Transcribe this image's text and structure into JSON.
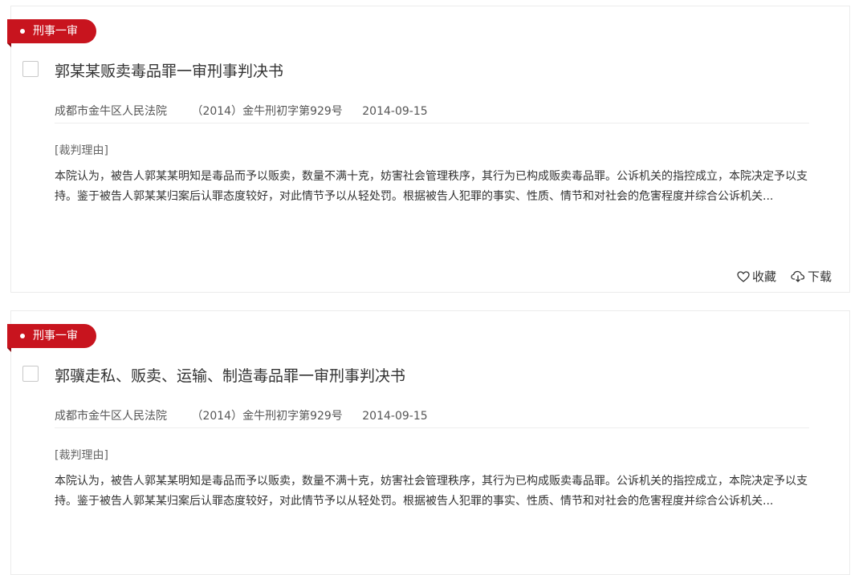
{
  "cards": [
    {
      "tag": "刑事一审",
      "title": "郭某某贩卖毒品罪一审刑事判决书",
      "court": "成都市金牛区人民法院",
      "case_number": "（2014）金牛刑初字第929号",
      "date": "2014-09-15",
      "reason_label": "[裁判理由]",
      "reason_text": "本院认为，被告人郭某某明知是毒品而予以贩卖，数量不满十克，妨害社会管理秩序，其行为已构成贩卖毒品罪。公诉机关的指控成立，本院决定予以支持。鉴于被告人郭某某归案后认罪态度较好，对此情节予以从轻处罚。根据被告人犯罪的事实、性质、情节和对社会的危害程度并综合公诉机关...",
      "favorite_label": "收藏",
      "download_label": "下载"
    },
    {
      "tag": "刑事一审",
      "title": "郭骥走私、贩卖、运输、制造毒品罪一审刑事判决书",
      "court": "成都市金牛区人民法院",
      "case_number": "（2014）金牛刑初字第929号",
      "date": "2014-09-15",
      "reason_label": "[裁判理由]",
      "reason_text": "本院认为，被告人郭某某明知是毒品而予以贩卖，数量不满十克，妨害社会管理秩序，其行为已构成贩卖毒品罪。公诉机关的指控成立，本院决定予以支持。鉴于被告人郭某某归案后认罪态度较好，对此情节予以从轻处罚。根据被告人犯罪的事实、性质、情节和对社会的危害程度并综合公诉机关..."
    }
  ],
  "colors": {
    "tag_red": "#c8141e",
    "tag_red_dark": "#8e0c13",
    "text_main": "#333333",
    "text_meta": "#555555",
    "border": "#ececec"
  },
  "icons": {
    "favorite": "heart-icon",
    "download": "cloud-download-icon"
  }
}
